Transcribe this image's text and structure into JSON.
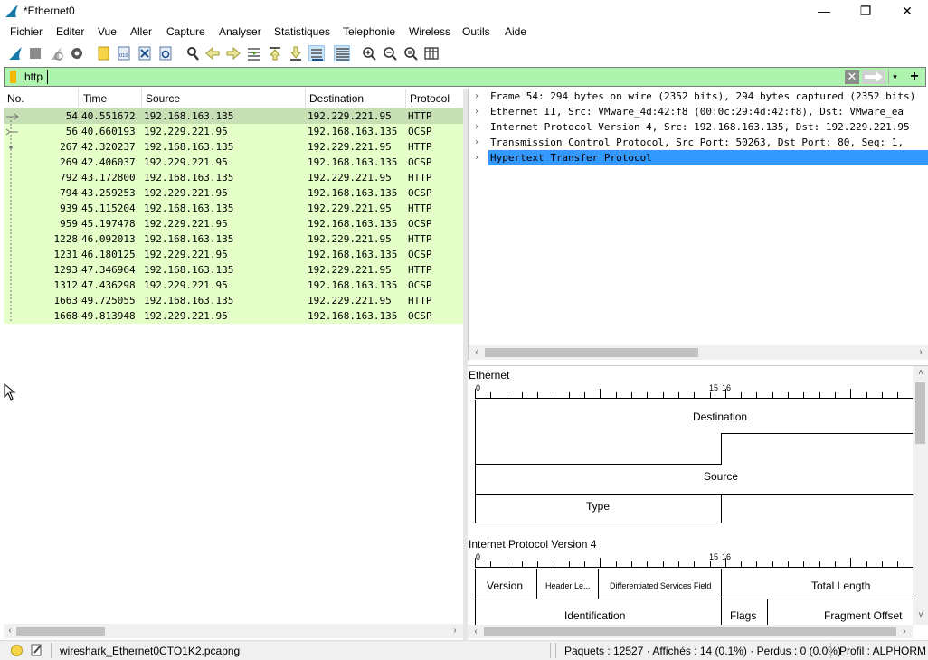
{
  "window": {
    "title": "*Ethernet0",
    "minimize": "—",
    "maximize": "❐",
    "close": "✕"
  },
  "menu": [
    "Fichier",
    "Editer",
    "Vue",
    "Aller",
    "Capture",
    "Analyser",
    "Statistiques",
    "Telephonie",
    "Wireless",
    "Outils",
    "Aide"
  ],
  "filter": {
    "value": "http",
    "clear": "✕",
    "dropdown": "▾",
    "add": "+"
  },
  "columns": {
    "no": "No.",
    "time": "Time",
    "source": "Source",
    "destination": "Destination",
    "protocol": "Protocol"
  },
  "packets": [
    {
      "no": "54",
      "time": "40.551672",
      "src": "192.168.163.135",
      "dst": "192.229.221.95",
      "proto": "HTTP"
    },
    {
      "no": "56",
      "time": "40.660193",
      "src": "192.229.221.95",
      "dst": "192.168.163.135",
      "proto": "OCSP"
    },
    {
      "no": "267",
      "time": "42.320237",
      "src": "192.168.163.135",
      "dst": "192.229.221.95",
      "proto": "HTTP"
    },
    {
      "no": "269",
      "time": "42.406037",
      "src": "192.229.221.95",
      "dst": "192.168.163.135",
      "proto": "OCSP"
    },
    {
      "no": "792",
      "time": "43.172800",
      "src": "192.168.163.135",
      "dst": "192.229.221.95",
      "proto": "HTTP"
    },
    {
      "no": "794",
      "time": "43.259253",
      "src": "192.229.221.95",
      "dst": "192.168.163.135",
      "proto": "OCSP"
    },
    {
      "no": "939",
      "time": "45.115204",
      "src": "192.168.163.135",
      "dst": "192.229.221.95",
      "proto": "HTTP"
    },
    {
      "no": "959",
      "time": "45.197478",
      "src": "192.229.221.95",
      "dst": "192.168.163.135",
      "proto": "OCSP"
    },
    {
      "no": "1228",
      "time": "46.092013",
      "src": "192.168.163.135",
      "dst": "192.229.221.95",
      "proto": "HTTP"
    },
    {
      "no": "1231",
      "time": "46.180125",
      "src": "192.229.221.95",
      "dst": "192.168.163.135",
      "proto": "OCSP"
    },
    {
      "no": "1293",
      "time": "47.346964",
      "src": "192.168.163.135",
      "dst": "192.229.221.95",
      "proto": "HTTP"
    },
    {
      "no": "1312",
      "time": "47.436298",
      "src": "192.229.221.95",
      "dst": "192.168.163.135",
      "proto": "OCSP"
    },
    {
      "no": "1663",
      "time": "49.725055",
      "src": "192.168.163.135",
      "dst": "192.229.221.95",
      "proto": "HTTP"
    },
    {
      "no": "1668",
      "time": "49.813948",
      "src": "192.229.221.95",
      "dst": "192.168.163.135",
      "proto": "OCSP"
    }
  ],
  "details": [
    "Frame 54: 294 bytes on wire (2352 bits), 294 bytes captured (2352 bits)",
    "Ethernet II, Src: VMware_4d:42:f8 (00:0c:29:4d:42:f8), Dst: VMware_ea",
    "Internet Protocol Version 4, Src: 192.168.163.135, Dst: 192.229.221.95",
    "Transmission Control Protocol, Src Port: 50263, Dst Port: 80, Seq: 1,",
    "Hypertext Transfer Protocol"
  ],
  "bytes_diagram": {
    "ethernet_title": "Ethernet",
    "ruler_labels": {
      "start": "0",
      "mid_a": "15",
      "mid_b": "16"
    },
    "ethernet_fields": {
      "destination": "Destination",
      "source": "Source",
      "type": "Type"
    },
    "ip_title": "Internet Protocol Version 4",
    "ip_fields": {
      "version": "Version",
      "header_length": "Header Le...",
      "dsf": "Differentiated Services Field",
      "total_length": "Total Length",
      "identification": "Identification",
      "flags": "Flags",
      "fragment_offset": "Fragment Offset"
    }
  },
  "statusbar": {
    "file": "wireshark_Ethernet0CTO1K2.pcapng",
    "stats": "Paquets : 12527 · Affichés : 14 (0.1%) · Perdus : 0 (0.0%)",
    "profile": "Profil : ALPHORM"
  },
  "colors": {
    "filter_ok": "#aef3ae",
    "row_http": "#e4ffc7",
    "row_selected": "#c7dfb4",
    "detail_selected": "#3399ff"
  }
}
